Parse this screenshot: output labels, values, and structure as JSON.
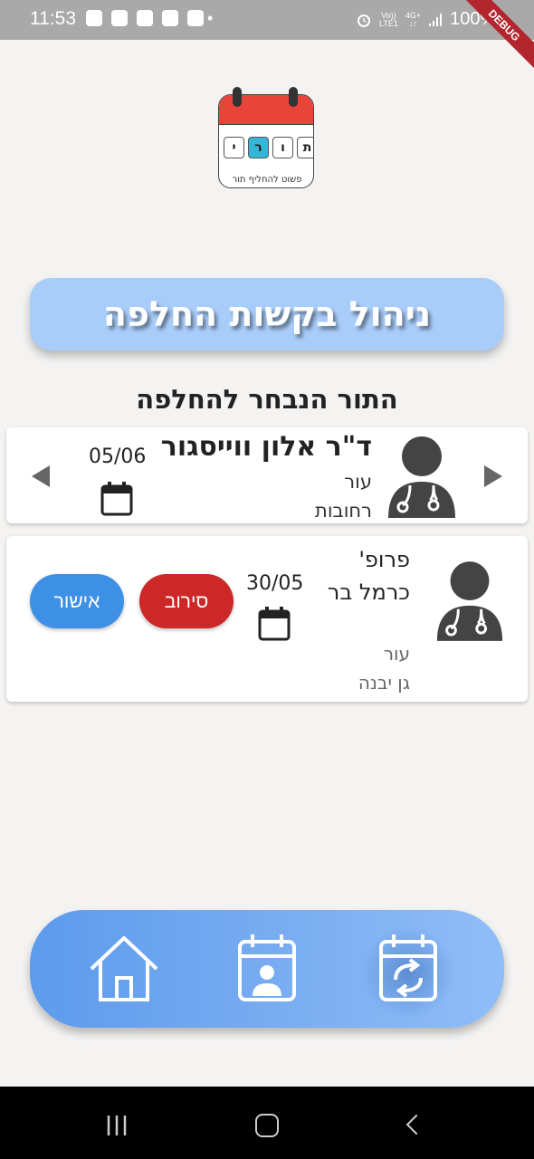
{
  "status_bar": {
    "time": "11:53",
    "dot": "•",
    "volte_top": "Vo))",
    "volte_bottom": "LTE1",
    "network": "4G+",
    "battery": "100%"
  },
  "debug_banner": "DEBUG",
  "logo": {
    "letters": [
      "ת",
      "ו",
      "ר",
      "י"
    ],
    "tagline": "פשוט להחליף תור"
  },
  "page_title": "ניהול בקשות החלפה",
  "section_title": "התור הנבחר להחלפה",
  "selected_appointment": {
    "doctor_name": "ד\"ר אלון ווייסגור",
    "specialty": "עור",
    "city": "רחובות",
    "date": "05/06"
  },
  "requests": [
    {
      "doctor_name": "פרופ' כרמל בר",
      "specialty": "עור",
      "city": "גן יבנה",
      "date": "30/05",
      "reject_label": "סירוב",
      "approve_label": "אישור"
    }
  ],
  "colors": {
    "accent": "#a9cdfa",
    "reject": "#cc2827",
    "approve": "#3e8fe6",
    "nav_gradient_start": "#5d9bec",
    "nav_gradient_end": "#8fbdf7"
  },
  "bottom_nav": [
    {
      "icon": "home-icon"
    },
    {
      "icon": "calendar-person-icon"
    },
    {
      "icon": "calendar-swap-icon",
      "active": true
    }
  ]
}
